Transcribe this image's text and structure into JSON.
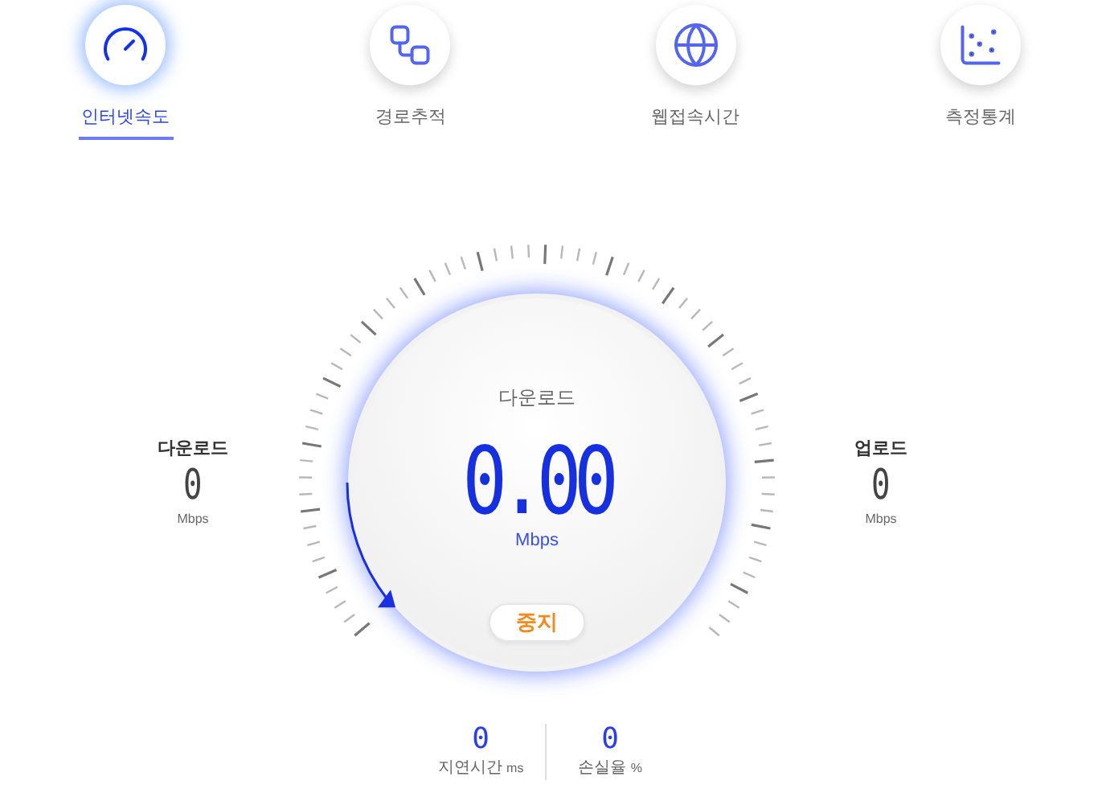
{
  "tabs": [
    {
      "label": "인터넷속도",
      "kind": "speed",
      "selected": true
    },
    {
      "label": "경로추적",
      "kind": "route",
      "selected": false
    },
    {
      "label": "웹접속시간",
      "kind": "globe",
      "selected": false
    },
    {
      "label": "측정통계",
      "kind": "stats",
      "selected": false
    }
  ],
  "side_stats": [
    {
      "label": "다운로드",
      "value": "0",
      "unit": "Mbps"
    },
    {
      "label": "업로드",
      "value": "0",
      "unit": "Mbps"
    }
  ],
  "gauge": {
    "title": "다운로드",
    "value": "0.00",
    "unit": "Mbps",
    "button": "중지"
  },
  "bottom_stats": [
    {
      "value": "0",
      "label": "지연시간",
      "unit": "ms"
    },
    {
      "value": "0",
      "label": "손실율",
      "unit": "%"
    }
  ]
}
